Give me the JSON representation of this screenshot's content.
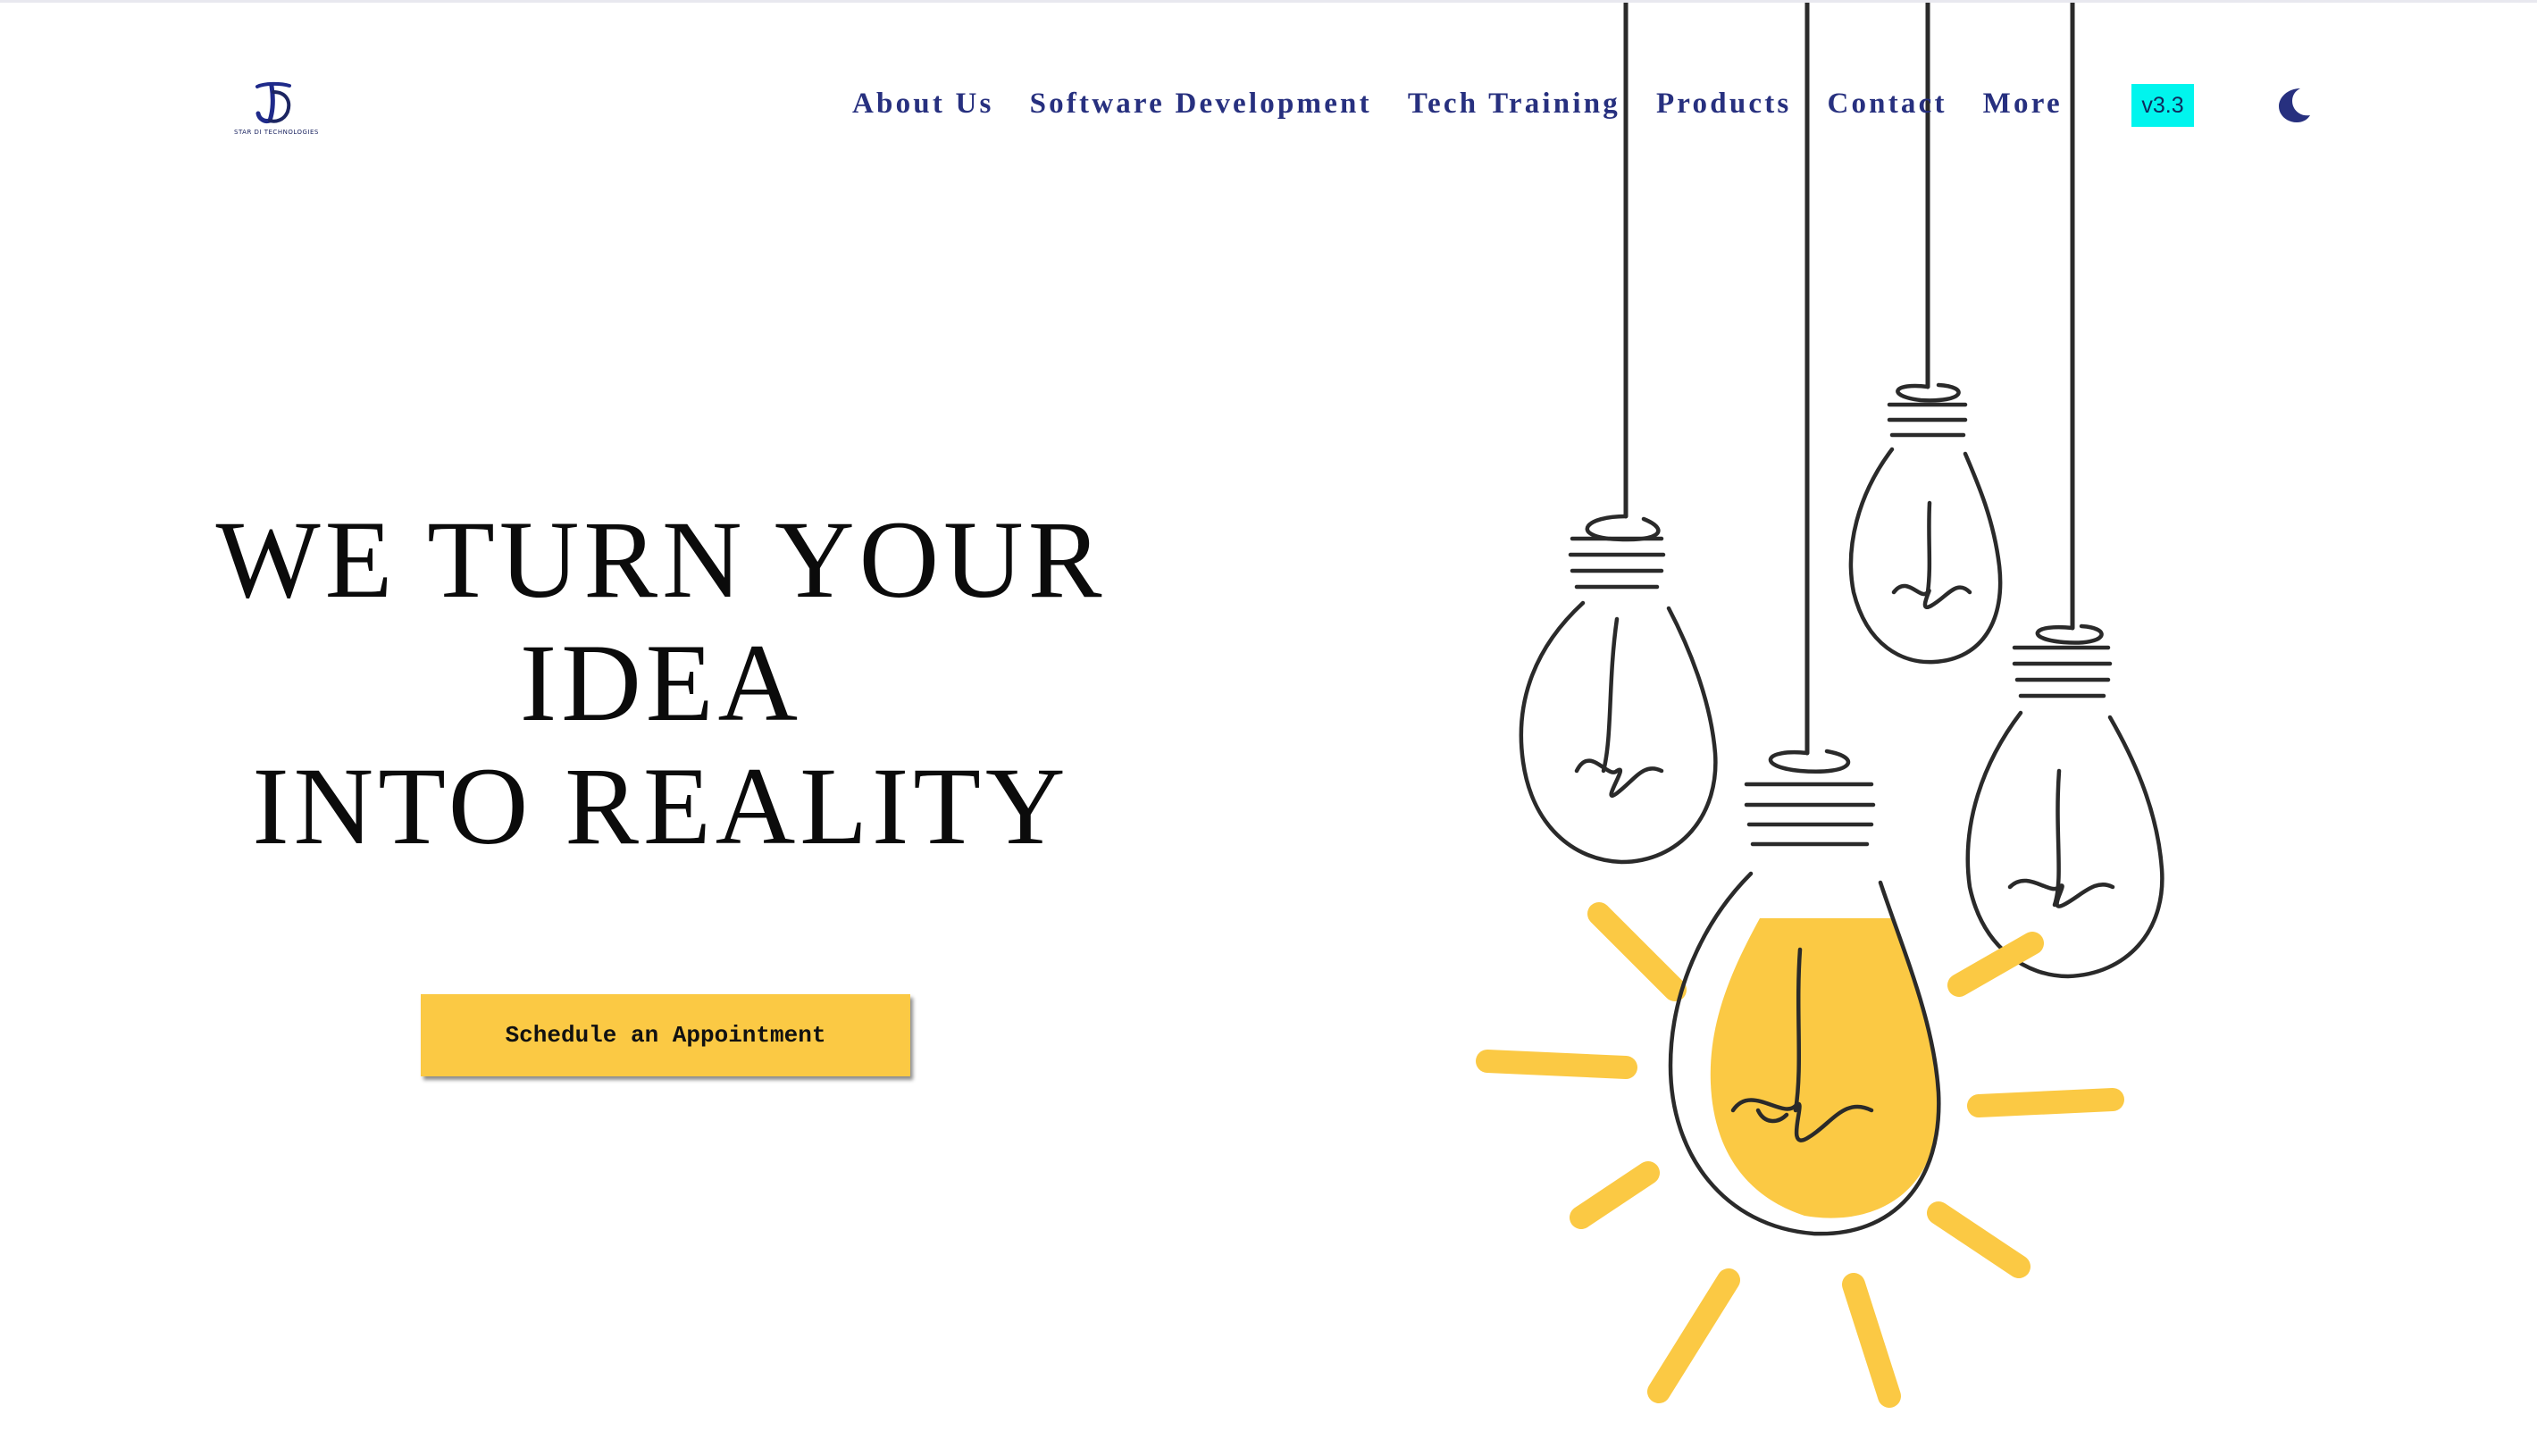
{
  "header": {
    "logo": {
      "monogram": "SD",
      "tagline": "STAR DI TECHNOLOGIES"
    },
    "nav": [
      {
        "label": "About Us"
      },
      {
        "label": "Software Development"
      },
      {
        "label": "Tech Training"
      },
      {
        "label": "Products"
      },
      {
        "label": "Contact"
      },
      {
        "label": "More"
      }
    ],
    "version_badge": "v3.3",
    "theme_toggle_icon": "moon-icon"
  },
  "hero": {
    "title_lines": [
      "WE TURN YOUR",
      "IDEA",
      "INTO REALITY"
    ],
    "cta_label": "Schedule an Appointment"
  },
  "illustration": {
    "subject": "hanging-light-bulbs",
    "accent_color": "#fbc944",
    "line_color": "#2a2a2a"
  },
  "colors": {
    "nav_text": "#27307f",
    "version_badge_bg": "#00f5ee",
    "cta_bg": "#fbc944",
    "hero_text": "#0b0b0b"
  }
}
